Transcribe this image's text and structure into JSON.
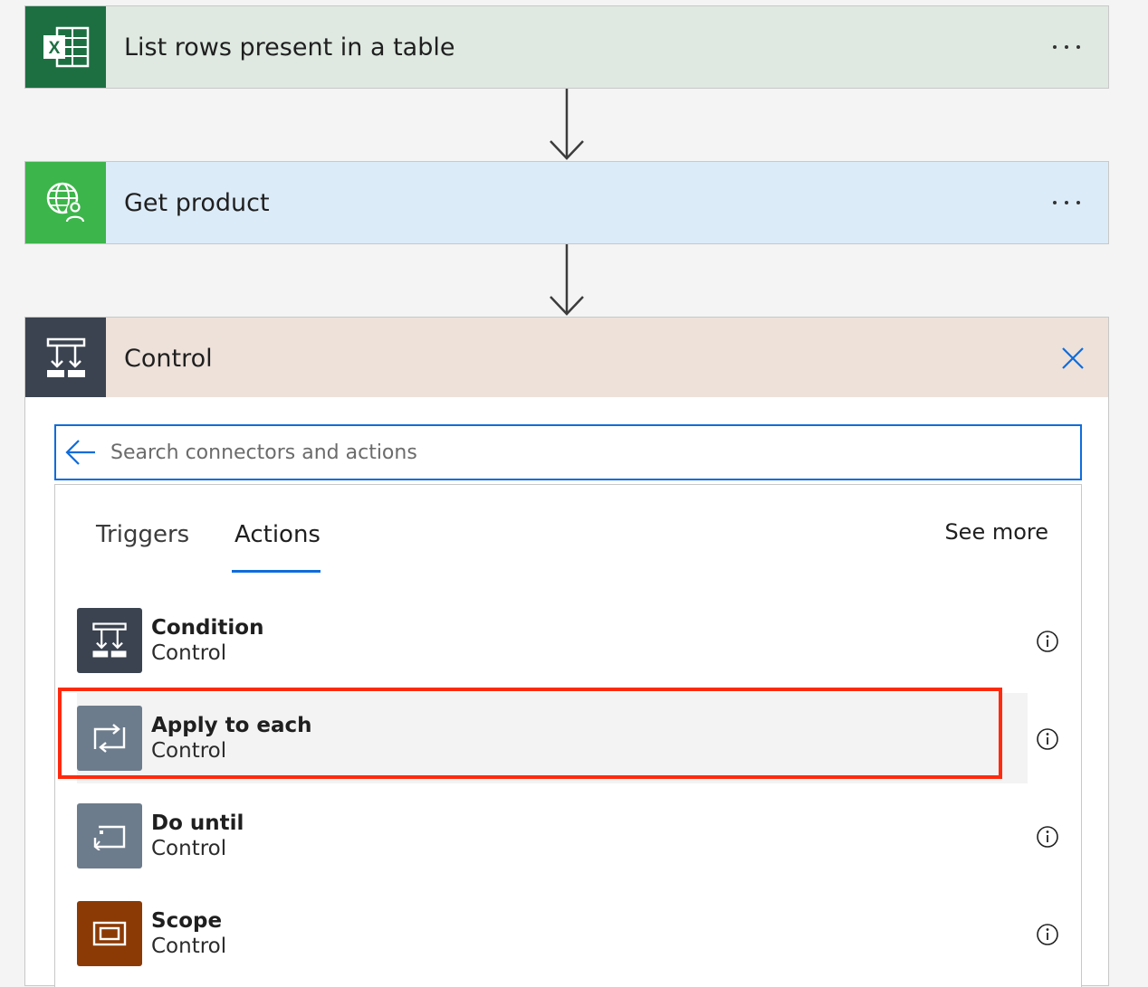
{
  "flow": {
    "step1": {
      "title": "List rows present in a table",
      "icon": "excel-icon",
      "color": "#1d6f42",
      "bg": "#dfe9e1"
    },
    "step2": {
      "title": "Get product",
      "icon": "globe-user-icon",
      "color": "#3cb54a",
      "bg": "#dcebf8"
    },
    "step3": {
      "title": "Control",
      "icon": "control-icon",
      "color": "#3b4350",
      "bg": "#ede1da"
    }
  },
  "search": {
    "placeholder": "Search connectors and actions",
    "value": ""
  },
  "tabs": [
    {
      "label": "Triggers",
      "active": false
    },
    {
      "label": "Actions",
      "active": true
    }
  ],
  "see_more": "See more",
  "actions": [
    {
      "name": "Condition",
      "connector": "Control",
      "icon": "condition-icon",
      "color": "#3b4350"
    },
    {
      "name": "Apply to each",
      "connector": "Control",
      "icon": "loop-icon",
      "color": "#6d7c8c"
    },
    {
      "name": "Do until",
      "connector": "Control",
      "icon": "do-until-icon",
      "color": "#6d7c8c"
    },
    {
      "name": "Scope",
      "connector": "Control",
      "icon": "scope-icon",
      "color": "#8b3a06"
    }
  ],
  "colors": {
    "accent": "#0f6cda",
    "highlight": "#ff2a0e"
  }
}
